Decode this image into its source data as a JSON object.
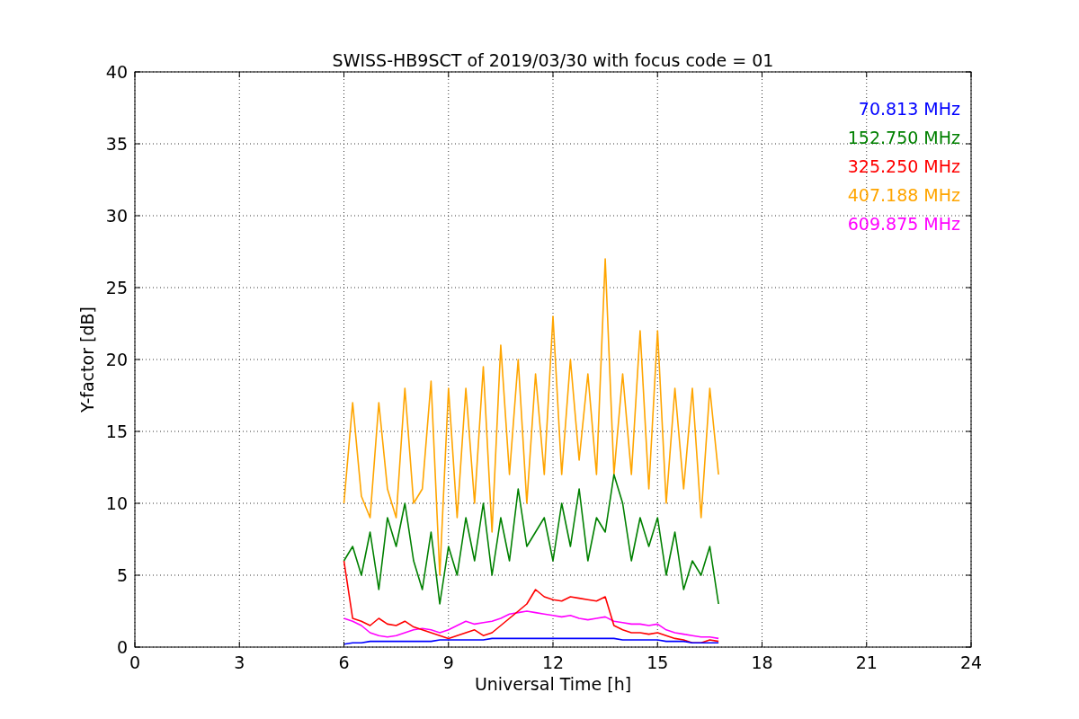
{
  "chart_data": {
    "type": "line",
    "title": "SWISS-HB9SCT of 2019/03/30 with focus code = 01",
    "xlabel": "Universal Time [h]",
    "ylabel": "Y-factor [dB]",
    "grid": true,
    "xlim": [
      0,
      24
    ],
    "ylim": [
      0,
      40
    ],
    "xticks": [
      0,
      3,
      6,
      9,
      12,
      15,
      18,
      21,
      24
    ],
    "yticks": [
      0,
      5,
      10,
      15,
      20,
      25,
      30,
      35,
      40
    ],
    "x": [
      6,
      6.25,
      6.5,
      6.75,
      7,
      7.25,
      7.5,
      7.75,
      8,
      8.25,
      8.5,
      8.75,
      9,
      9.25,
      9.5,
      9.75,
      10,
      10.25,
      10.5,
      10.75,
      11,
      11.25,
      11.5,
      11.75,
      12,
      12.25,
      12.5,
      12.75,
      13,
      13.25,
      13.5,
      13.75,
      14,
      14.25,
      14.5,
      14.75,
      15,
      15.25,
      15.5,
      15.75,
      16,
      16.25,
      16.5,
      16.75
    ],
    "series": [
      {
        "name": "70.813 MHz",
        "color": "#0000ff",
        "values": [
          0.2,
          0.3,
          0.3,
          0.4,
          0.4,
          0.4,
          0.4,
          0.4,
          0.4,
          0.4,
          0.4,
          0.5,
          0.5,
          0.5,
          0.5,
          0.5,
          0.5,
          0.6,
          0.6,
          0.6,
          0.6,
          0.6,
          0.6,
          0.6,
          0.6,
          0.6,
          0.6,
          0.6,
          0.6,
          0.6,
          0.6,
          0.6,
          0.5,
          0.5,
          0.5,
          0.5,
          0.5,
          0.4,
          0.4,
          0.4,
          0.3,
          0.3,
          0.3,
          0.3
        ]
      },
      {
        "name": "152.750 MHz",
        "color": "#008000",
        "values": [
          6,
          7,
          5,
          8,
          4,
          9,
          7,
          10,
          6,
          4,
          8,
          3,
          7,
          5,
          9,
          6,
          10,
          5,
          9,
          6,
          11,
          7,
          8,
          9,
          6,
          10,
          7,
          11,
          6,
          9,
          8,
          12,
          10,
          6,
          9,
          7,
          9,
          5,
          8,
          4,
          6,
          5,
          7,
          3
        ]
      },
      {
        "name": "325.250 MHz",
        "color": "#ff0000",
        "values": [
          6,
          2,
          1.8,
          1.5,
          2,
          1.6,
          1.5,
          1.8,
          1.4,
          1.2,
          1,
          0.8,
          0.6,
          0.8,
          1,
          1.2,
          0.8,
          1,
          1.5,
          2,
          2.5,
          3,
          4,
          3.5,
          3.3,
          3.2,
          3.5,
          3.4,
          3.3,
          3.2,
          3.5,
          1.5,
          1.2,
          1,
          1,
          0.9,
          1,
          0.8,
          0.6,
          0.5,
          0.3,
          0.3,
          0.5,
          0.4
        ]
      },
      {
        "name": "407.188 MHz",
        "color": "#ffa500",
        "values": [
          10,
          17,
          10.5,
          9,
          17,
          11,
          9,
          18,
          10,
          11,
          18.5,
          5,
          18,
          9,
          18,
          10,
          19.5,
          8,
          21,
          12,
          20,
          10,
          19,
          12,
          23,
          12,
          20,
          13,
          19,
          12,
          27,
          12,
          19,
          12,
          22,
          11,
          22,
          10,
          18,
          11,
          18,
          9,
          18,
          12
        ]
      },
      {
        "name": "609.875 MHz",
        "color": "#ff00ff",
        "values": [
          2,
          1.8,
          1.5,
          1,
          0.8,
          0.7,
          0.8,
          1,
          1.2,
          1.3,
          1.2,
          1,
          1.2,
          1.5,
          1.8,
          1.6,
          1.7,
          1.8,
          2,
          2.3,
          2.4,
          2.5,
          2.4,
          2.3,
          2.2,
          2.1,
          2.2,
          2,
          1.9,
          2,
          2.1,
          1.8,
          1.7,
          1.6,
          1.6,
          1.5,
          1.6,
          1.2,
          1,
          0.9,
          0.8,
          0.7,
          0.7,
          0.6
        ]
      }
    ]
  }
}
